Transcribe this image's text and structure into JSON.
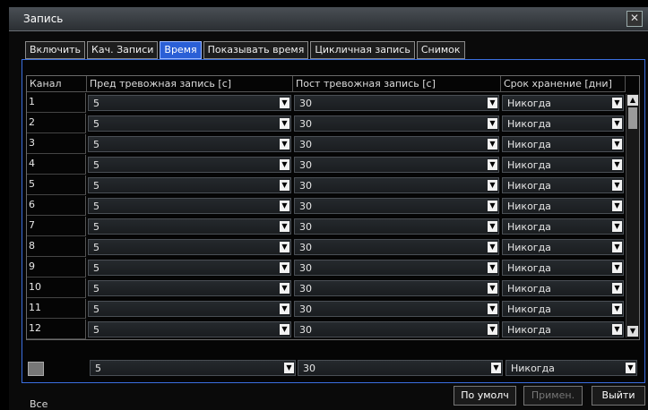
{
  "window": {
    "title": "Запись",
    "close_glyph": "✕"
  },
  "tabs": [
    {
      "label": "Включить",
      "active": false
    },
    {
      "label": "Кач. Записи",
      "active": false
    },
    {
      "label": "Время",
      "active": true
    },
    {
      "label": "Показывать время",
      "active": false
    },
    {
      "label": "Цикличная запись",
      "active": false
    },
    {
      "label": "Снимок",
      "active": false
    }
  ],
  "table": {
    "headers": [
      "Канал",
      "Пред тревожная запись [с]",
      "Пост тревожная запись [с]",
      "Срок хранение [дни]"
    ],
    "rows": [
      {
        "channel": "1",
        "pre": "5",
        "post": "30",
        "keep": "Никогда"
      },
      {
        "channel": "2",
        "pre": "5",
        "post": "30",
        "keep": "Никогда"
      },
      {
        "channel": "3",
        "pre": "5",
        "post": "30",
        "keep": "Никогда"
      },
      {
        "channel": "4",
        "pre": "5",
        "post": "30",
        "keep": "Никогда"
      },
      {
        "channel": "5",
        "pre": "5",
        "post": "30",
        "keep": "Никогда"
      },
      {
        "channel": "6",
        "pre": "5",
        "post": "30",
        "keep": "Никогда"
      },
      {
        "channel": "7",
        "pre": "5",
        "post": "30",
        "keep": "Никогда"
      },
      {
        "channel": "8",
        "pre": "5",
        "post": "30",
        "keep": "Никогда"
      },
      {
        "channel": "9",
        "pre": "5",
        "post": "30",
        "keep": "Никогда"
      },
      {
        "channel": "10",
        "pre": "5",
        "post": "30",
        "keep": "Никогда"
      },
      {
        "channel": "11",
        "pre": "5",
        "post": "30",
        "keep": "Никогда"
      },
      {
        "channel": "12",
        "pre": "5",
        "post": "30",
        "keep": "Никогда"
      }
    ]
  },
  "all": {
    "label": "Все",
    "pre": "5",
    "post": "30",
    "keep": "Никогда",
    "checked": false
  },
  "buttons": {
    "default": "По умолч",
    "apply": "Примен.",
    "exit": "Выйти"
  },
  "colors": {
    "accent": "#2a5fd6",
    "frame": "#3b6fe0"
  },
  "icons": {
    "dropdown": "chevron-down-icon",
    "close": "close-icon",
    "scroll_up": "arrow-up-icon",
    "scroll_down": "arrow-down-icon"
  }
}
